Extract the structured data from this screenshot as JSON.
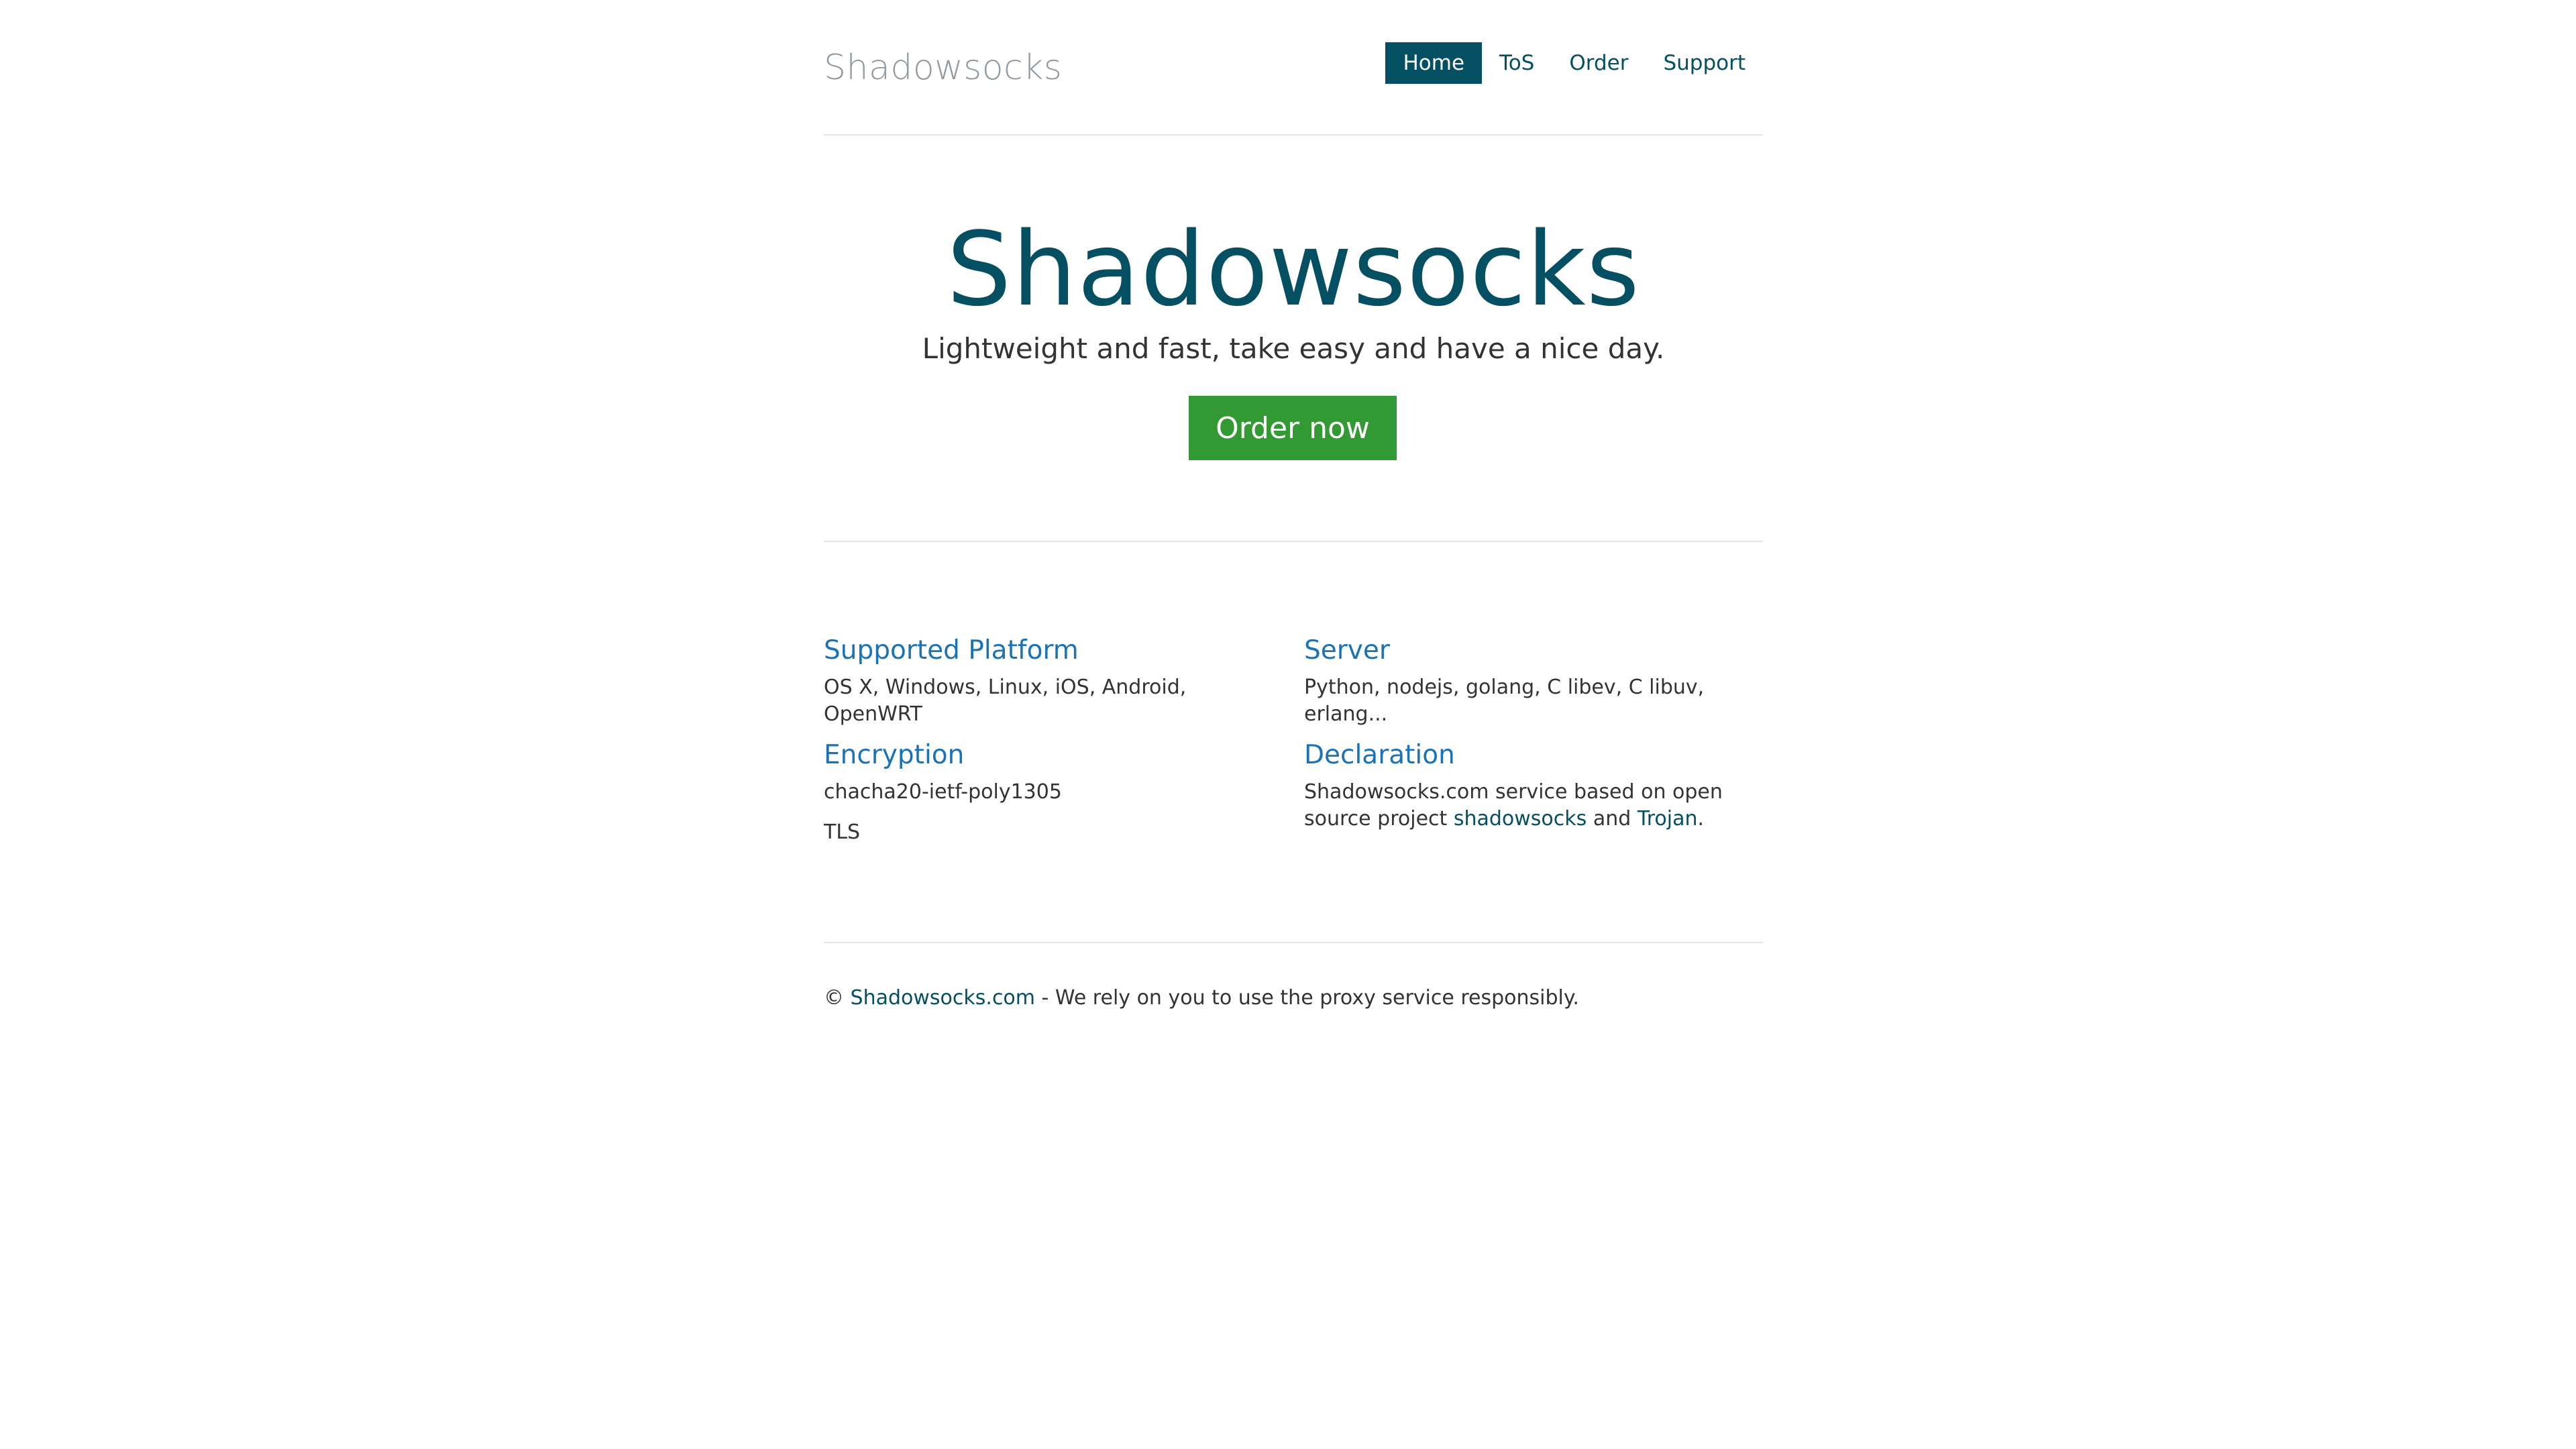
{
  "header": {
    "brand": "Shadowsocks",
    "nav": [
      {
        "label": "Home",
        "active": true
      },
      {
        "label": "ToS"
      },
      {
        "label": "Order"
      },
      {
        "label": "Support"
      }
    ]
  },
  "hero": {
    "title": "Shadowsocks",
    "tagline": "Lightweight and fast, take easy and have a nice day.",
    "button_label": "Order now"
  },
  "features": {
    "platform": {
      "title": "Supported Platform",
      "text": "OS X, Windows, Linux, iOS, Android, OpenWRT"
    },
    "server": {
      "title": "Server",
      "text": "Python, nodejs, golang, C libev, C libuv, erlang..."
    },
    "encryption": {
      "title": "Encryption",
      "lines": [
        "chacha20-ietf-poly1305",
        "TLS"
      ]
    },
    "declaration": {
      "title": "Declaration",
      "text_before": "Shadowsocks.com service based on open source project ",
      "link1": "shadowsocks",
      "text_between": " and ",
      "link2": "Trojan",
      "text_after": "."
    }
  },
  "footer": {
    "copyright": "© ",
    "link": "Shadowsocks.com",
    "text": " - We rely on you to use the proxy service responsibly."
  },
  "colors": {
    "primary": "#054f63",
    "accent_button": "#339933",
    "feature_title": "#1a73b8",
    "brand_gray": "#909aa0"
  }
}
